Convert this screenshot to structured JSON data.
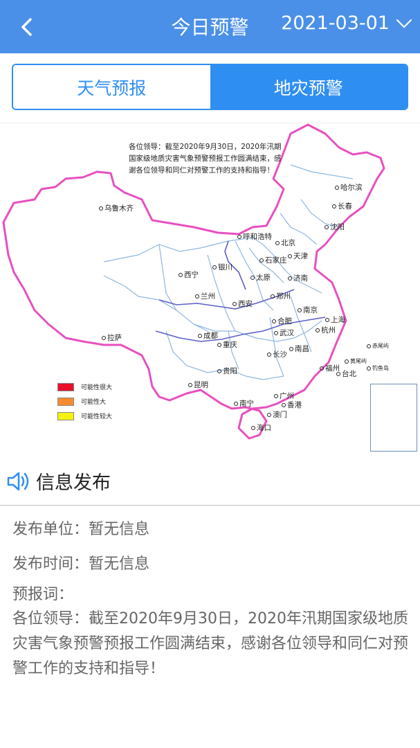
{
  "header": {
    "title": "今日预警",
    "date": "2021-03-01"
  },
  "tabs": [
    {
      "label": "天气预报",
      "active": false
    },
    {
      "label": "地灾预警",
      "active": true
    }
  ],
  "map": {
    "notice": "各位领导：截至2020年9月30日，2020年汛期国家级地质灾害气象预警预报工作圆满结束，感谢各位领导和同仁对预警工作的支持和指导！",
    "legend": [
      {
        "label": "可能性很大",
        "color": "#e8102a"
      },
      {
        "label": "可能性大",
        "color": "#f58c32"
      },
      {
        "label": "可能性较大",
        "color": "#f5f20c"
      }
    ],
    "cities": [
      "乌鲁木齐",
      "哈尔滨",
      "长春",
      "沈阳",
      "呼和浩特",
      "北京",
      "天津",
      "石家庄",
      "银川",
      "太原",
      "济南",
      "西宁",
      "兰州",
      "郑州",
      "西安",
      "南京",
      "合肥",
      "上海",
      "拉萨",
      "成都",
      "武汉",
      "杭州",
      "重庆",
      "南昌",
      "长沙",
      "福州",
      "贵阳",
      "台北",
      "昆明",
      "广州",
      "南宁",
      "香港",
      "澳门",
      "海口",
      "赤尾屿",
      "黄尾屿",
      "钓鱼岛"
    ]
  },
  "info": {
    "section_title": "信息发布",
    "unit_label": "发布单位：",
    "unit_value": "暂无信息",
    "time_label": "发布时间：",
    "time_value": "暂无信息",
    "forecast_label": "预报词：",
    "forecast_text": "各位领导：截至2020年9月30日，2020年汛期国家级地质灾害气象预警预报工作圆满结束，感谢各位领导和同仁对预警工作的支持和指导！"
  },
  "colors": {
    "header_bg": "#4a90e8",
    "tab_accent": "#2f8ef2",
    "border_pink": "#e84fc0",
    "river_blue": "#4a8fd8"
  },
  "icons": [
    "back-chevron-icon",
    "dropdown-chevron-icon",
    "speaker-icon"
  ]
}
